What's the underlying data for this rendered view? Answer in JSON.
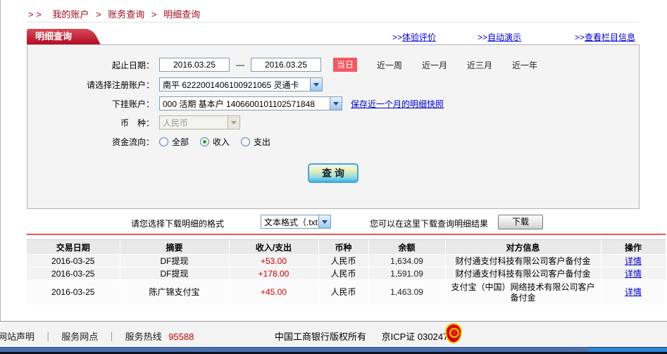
{
  "breadcrumb": {
    "prefix": "> >",
    "separator": ">",
    "items": [
      "我的账户",
      "账务查询",
      "明细查询"
    ]
  },
  "tab_title": "明细查询",
  "panel_links": [
    {
      "prefix": ">>",
      "label": "体验评价"
    },
    {
      "prefix": ">>",
      "label": "自动演示"
    },
    {
      "prefix": ">>",
      "label": "查看栏目信息"
    }
  ],
  "form": {
    "date_label": "起止日期：",
    "date_from": "2016.03.25",
    "date_to": "2016.03.25",
    "date_dash": "—",
    "quick_ranges": [
      {
        "label": "当日",
        "active": true
      },
      {
        "label": "近一周",
        "active": false
      },
      {
        "label": "近一月",
        "active": false
      },
      {
        "label": "近三月",
        "active": false
      },
      {
        "label": "近一年",
        "active": false
      }
    ],
    "register_account_label": "请选择注册账户：",
    "register_account_value": "南平  6222001406100921065  灵通卡",
    "sub_account_label": "下挂账户：",
    "sub_account_value": "000  活期  基本户  1406600101102571848",
    "snapshot_link": "保存近一个月的明细快照",
    "currency_label": "币　种：",
    "currency_value": "人民币",
    "flow_label": "资金流向：",
    "flow_options": [
      {
        "label": "全部",
        "checked": false
      },
      {
        "label": "收入",
        "checked": true
      },
      {
        "label": "支出",
        "checked": false
      }
    ],
    "query_button": "查 询"
  },
  "download": {
    "format_label": "请您选择下载明细的格式",
    "format_value": "文本格式（.txt）",
    "hint": "您可以在这里下载查询明细结果",
    "button_label": "下载"
  },
  "table": {
    "headers": [
      "交易日期",
      "摘要",
      "收入/支出",
      "币种",
      "余额",
      "对方信息",
      "操作"
    ],
    "rows": [
      {
        "date": "2016-03-25",
        "summary": "DF提现",
        "amount": "+53.00",
        "currency": "人民币",
        "balance": "1,634.09",
        "counterparty": "财付通支付科技有限公司客户备付金",
        "action": "详情"
      },
      {
        "date": "2016-03-25",
        "summary": "DF提现",
        "amount": "+178.00",
        "currency": "人民币",
        "balance": "1,591.09",
        "counterparty": "财付通支付科技有限公司客户备付金",
        "action": "详情"
      },
      {
        "date": "2016-03-25",
        "summary": "陈广锦支付宝",
        "amount": "+45.00",
        "currency": "人民币",
        "balance": "1,463.09",
        "counterparty": "支付宝（中国）网络技术有限公司客户备付金",
        "action": "详情"
      }
    ]
  },
  "footer": {
    "link_statement": "网站声明",
    "link_branches": "服务网点",
    "separator": "｜",
    "hotline_label": "服务热线",
    "hotline_number": "95588",
    "copyright": "中国工商银行版权所有",
    "icp": "京ICP证 030247号"
  },
  "colors": {
    "brand_red": "#b00d26",
    "accent_rule_red": "#e45556",
    "today_badge_red": "#f25862",
    "link_blue": "#0000cc",
    "amount_red": "#cc0000",
    "bottom_bar_steel": "#4a6fb0",
    "bottom_bar_blue": "#2b86da"
  }
}
